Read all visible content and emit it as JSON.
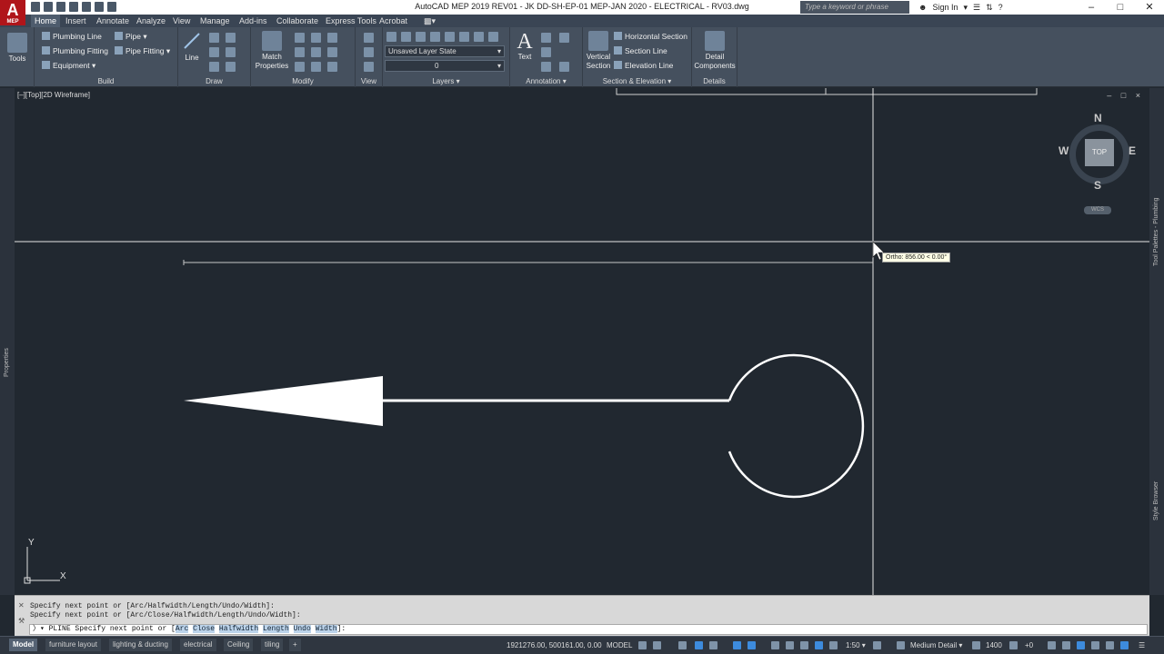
{
  "window": {
    "app_badge": "A",
    "app_badge_sub": "MEP",
    "title": "AutoCAD MEP 2019    REV01 - JK DD-SH-EP-01 MEP-JAN 2020 - ELECTRICAL - RV03.dwg",
    "search_placeholder": "Type a keyword or phrase",
    "signin_label": "Sign In"
  },
  "ribbon_tabs": [
    "Home",
    "Insert",
    "Annotate",
    "Analyze",
    "View",
    "Manage",
    "Add-ins",
    "Collaborate",
    "Express Tools",
    "Acrobat"
  ],
  "ribbon": {
    "tools_label": "Tools",
    "build": {
      "label": "Build",
      "plumbing_line": "Plumbing Line",
      "plumbing_fitting": "Plumbing Fitting",
      "equipment": "Equipment",
      "pipe": "Pipe",
      "pipe_fitting": "Pipe Fitting"
    },
    "draw": {
      "label": "Draw",
      "line": "Line"
    },
    "modify": {
      "label": "Modify",
      "match_properties": "Match Properties"
    },
    "view": {
      "label": "View"
    },
    "layers": {
      "label": "Layers",
      "layer_state": "Unsaved Layer State",
      "current_layer": "0"
    },
    "annotation": {
      "label": "Annotation",
      "text": "Text"
    },
    "section": {
      "label": "Section & Elevation",
      "vertical_section": "Vertical Section",
      "horizontal_section": "Horizontal Section",
      "section_line": "Section Line",
      "elevation_line": "Elevation Line"
    },
    "details": {
      "label": "Details",
      "detail_components": "Detail Components"
    }
  },
  "viewport": {
    "label": "[–][Top][2D Wireframe]",
    "controls": "– □ ×",
    "viewcube": {
      "n": "N",
      "s": "S",
      "e": "E",
      "w": "W",
      "face": "TOP",
      "wcs": "WCS"
    },
    "ucs": {
      "x": "X",
      "y": "Y"
    },
    "tooltip": "Ortho: 856.00 < 0.00°"
  },
  "side_palettes": {
    "left": "Properties",
    "right_top": "Tool Palettes - Plumbing",
    "right_bottom": "Style Browser"
  },
  "command": {
    "history": [
      "Specify next point or [Arc/Halfwidth/Length/Undo/Width]:",
      "Specify next point or [Arc/Close/Halfwidth/Length/Undo/Width]:"
    ],
    "prompt": "PLINE Specify next point or [",
    "options": [
      "Arc",
      "Close",
      "Halfwidth",
      "Length",
      "Undo",
      "Width"
    ],
    "prompt_end": "]:"
  },
  "layout_tabs": [
    "Model",
    "furniture layout",
    "lighting & ducting",
    "electrical",
    "Ceiling",
    "tiling"
  ],
  "status": {
    "coords": "1921276.00, 500161.00, 0.00",
    "space": "MODEL",
    "scale": "1:50",
    "detail": "Medium Detail",
    "elevation": "1400",
    "offset": "+0"
  }
}
